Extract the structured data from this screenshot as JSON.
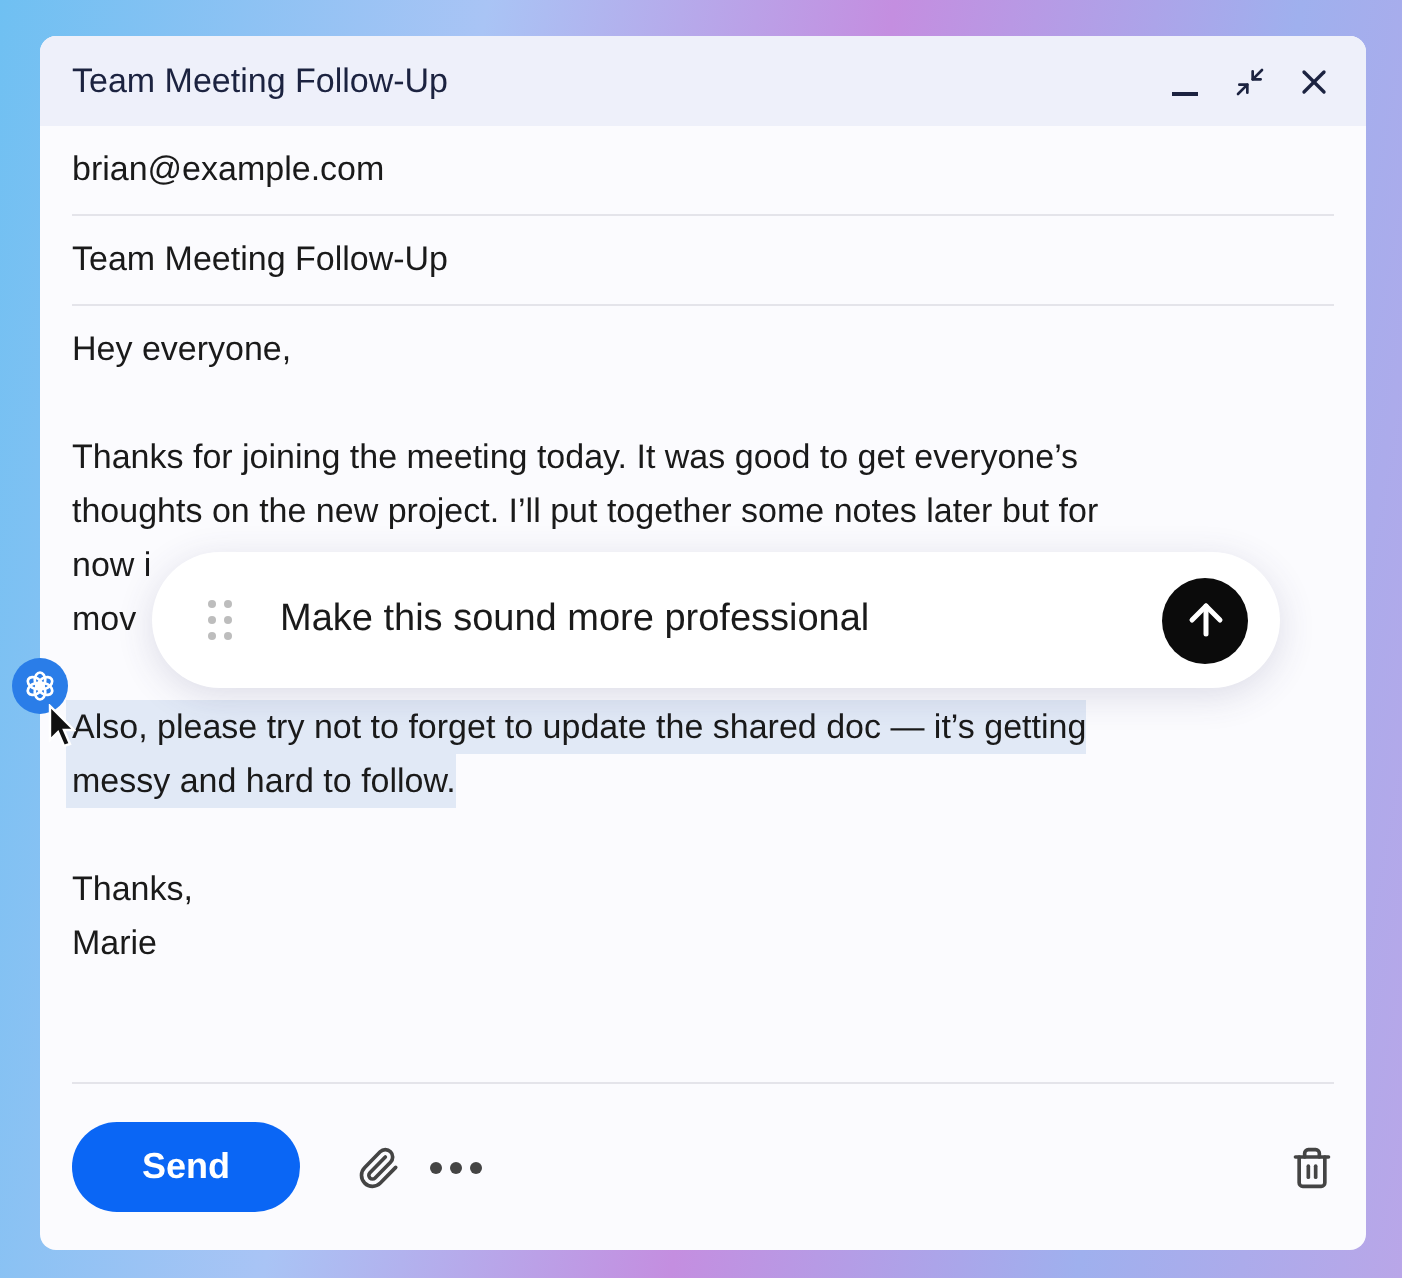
{
  "window": {
    "title": "Team Meeting Follow-Up"
  },
  "to": "brian@example.com",
  "subject": "Team Meeting Follow-Up",
  "body": [
    {
      "lines": [
        "Hey everyone,"
      ],
      "selected": false
    },
    {
      "lines": [
        "Thanks for joining the meeting today. It was good to get everyone’s",
        "thoughts on the new project. I’ll put together some notes later but for",
        "now i",
        "mov"
      ],
      "selected": false
    },
    {
      "lines": [
        "Also, please try not to forget to update the shared doc — it’s getting",
        "messy and hard to follow."
      ],
      "selected": true
    },
    {
      "lines": [
        "Thanks,",
        "Marie"
      ],
      "selected": false
    }
  ],
  "prompt": {
    "value": "Make this sound more professional"
  },
  "footer": {
    "send": "Send"
  }
}
